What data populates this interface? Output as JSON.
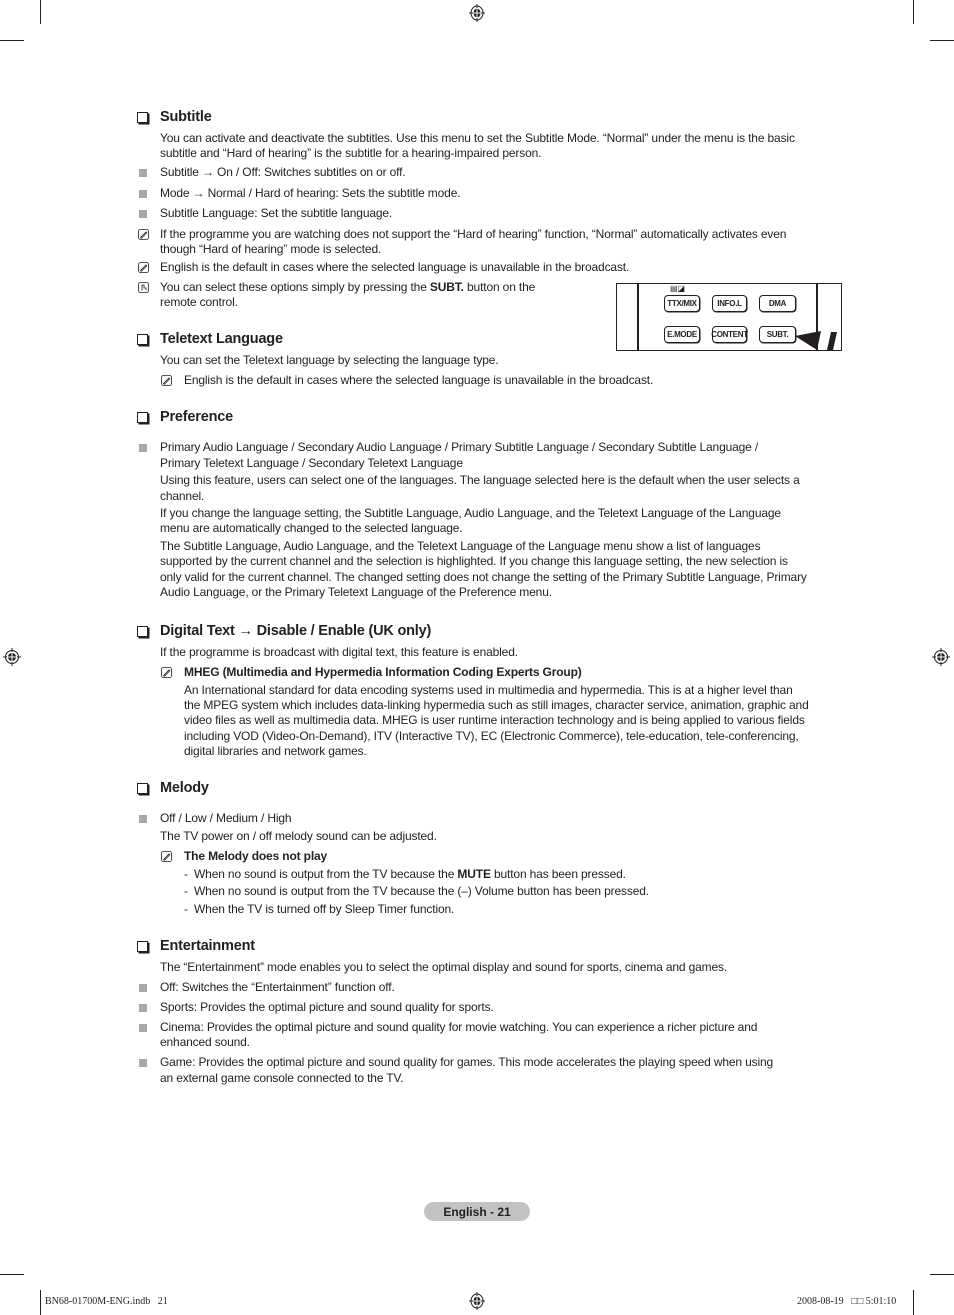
{
  "sections": {
    "subtitle": {
      "title": "Subtitle",
      "intro_1": "You can activate and deactivate the subtitles. Use this menu to set the Subtitle Mode. “Normal” under the menu is the basic",
      "intro_2": "subtitle and “Hard of hearing” is the subtitle for a hearing-impaired person.",
      "bullets": [
        "Subtitle → On / Off: Switches subtitles on or off.",
        "Mode → Normal / Hard of hearing: Sets the subtitle mode.",
        "Subtitle Language: Set the subtitle language."
      ],
      "note_1a": "If the programme you are watching does not support the “Hard of hearing” function, “Normal” automatically activates even",
      "note_1b": "though “Hard of hearing” mode is selected.",
      "note_2": "English is the default in cases where the selected language is unavailable in the broadcast.",
      "remote_note_pre": "You can select these options simply by pressing the ",
      "remote_note_bold": "SUBT.",
      "remote_note_post": " button on the",
      "remote_note_2": "remote control."
    },
    "remote": {
      "buttons_row1": [
        "TTX/MIX",
        "INFO.L",
        "DMA"
      ],
      "buttons_row2": [
        "E.MODE",
        "CONTENT",
        "SUBT."
      ]
    },
    "teletext": {
      "title": "Teletext Language",
      "intro": "You can set the Teletext language by selecting the language type.",
      "note": "English is the default in cases where the selected language is unavailable in the broadcast."
    },
    "preference": {
      "title": "Preference",
      "bullet_1": "Primary Audio Language / Secondary Audio Language / Primary Subtitle Language / Secondary Subtitle Language /",
      "bullet_2": "Primary Teletext Language / Secondary Teletext Language",
      "p1a": "Using this feature, users can select one of the languages. The language selected here is the default when the user selects a",
      "p1b": "channel.",
      "p2a": "If you change the language setting, the Subtitle Language, Audio Language, and the Teletext Language of the Language",
      "p2b": "menu are automatically changed to the selected language.",
      "p3a": "The Subtitle Language, Audio Language, and the Teletext Language of the Language menu show a list of languages",
      "p3b": "supported by the current channel and the selection is highlighted. If you change this language setting, the new selection is",
      "p3c": "only valid for the current channel. The changed setting does not change the setting of the Primary Subtitle Language, Primary",
      "p3d": "Audio Language, or the Primary Teletext Language of the Preference menu."
    },
    "digital_text": {
      "title": "Digital Text → Disable / Enable (UK only)",
      "intro": "If the programme is broadcast with digital text, this feature is enabled.",
      "note_title": "MHEG (Multimedia and Hypermedia Information Coding Experts Group)",
      "lines": [
        "An International standard for data encoding systems used in multimedia and hypermedia. This is at a higher level than",
        "the MPEG system which includes data-linking hypermedia such as still images, character service, animation, graphic and",
        "video files as well as multimedia data. MHEG is user runtime interaction technology and is being applied to various fields",
        "including VOD (Video-On-Demand), ITV (Interactive TV), EC (Electronic Commerce), tele-education, tele-conferencing,",
        "digital libraries and network games."
      ]
    },
    "melody": {
      "title": "Melody",
      "bullet": "Off / Low / Medium / High",
      "desc": "The TV power on / off melody sound can be adjusted.",
      "note_title": "The Melody does not play",
      "item_1_pre": "When no sound is output from the TV because the ",
      "item_1_bold": "MUTE",
      "item_1_post": " button has been pressed.",
      "item_2": "When no sound is output from the TV because the (–) Volume button has been pressed.",
      "item_3": "When the TV is turned off by Sleep Timer function.",
      "dash": "-"
    },
    "entertainment": {
      "title": "Entertainment",
      "intro": "The “Entertainment” mode enables you to select the optimal display and sound for sports, cinema and games.",
      "b1": "Off: Switches the “Entertainment” function off.",
      "b2": "Sports: Provides the optimal picture and sound quality for sports.",
      "b3a": "Cinema: Provides the optimal picture and sound quality for movie watching. You can experience a richer picture and",
      "b3b": "enhanced sound.",
      "b4a": "Game: Provides the optimal picture and sound quality for games. This mode accelerates the playing speed when using",
      "b4b": "an external game console connected to the TV."
    }
  },
  "footer": {
    "page_label": "English - 21",
    "file_info": "BN68-01700M-ENG.indb   21",
    "timestamp": "2008-08-19   □□ 5:01:10"
  }
}
